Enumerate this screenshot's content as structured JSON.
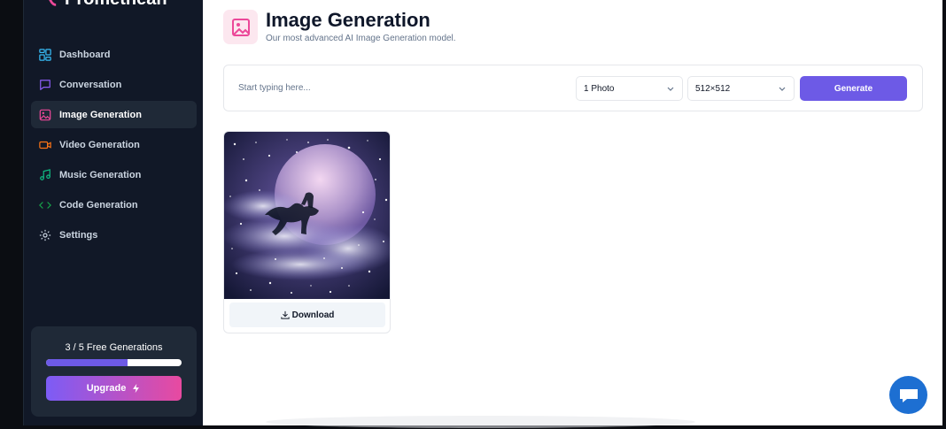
{
  "app": {
    "name": "Promethean",
    "brand_color": "#6d5ae6",
    "accent_pink": "#e84aa0"
  },
  "sidebar": {
    "items": [
      {
        "label": "Dashboard",
        "icon": "dashboard-icon",
        "color": "#38bdf8"
      },
      {
        "label": "Conversation",
        "icon": "chat-icon",
        "color": "#8b5cf6"
      },
      {
        "label": "Image Generation",
        "icon": "image-icon",
        "color": "#ec4899",
        "active": true
      },
      {
        "label": "Video Generation",
        "icon": "video-icon",
        "color": "#f97316"
      },
      {
        "label": "Music Generation",
        "icon": "music-icon",
        "color": "#10b981"
      },
      {
        "label": "Code Generation",
        "icon": "code-icon",
        "color": "#16a34a"
      },
      {
        "label": "Settings",
        "icon": "settings-icon",
        "color": "#cbd5e1"
      }
    ]
  },
  "free_tier": {
    "text": "3 / 5 Free Generations",
    "progress": 0.6,
    "upgrade_label": "Upgrade"
  },
  "page": {
    "title": "Image Generation",
    "subtitle": "Our most advanced AI Image Generation model."
  },
  "form": {
    "placeholder": "Start typing here...",
    "amount": "1 Photo",
    "resolution": "512×512",
    "generate_label": "Generate"
  },
  "result": {
    "download_label": "Download"
  }
}
